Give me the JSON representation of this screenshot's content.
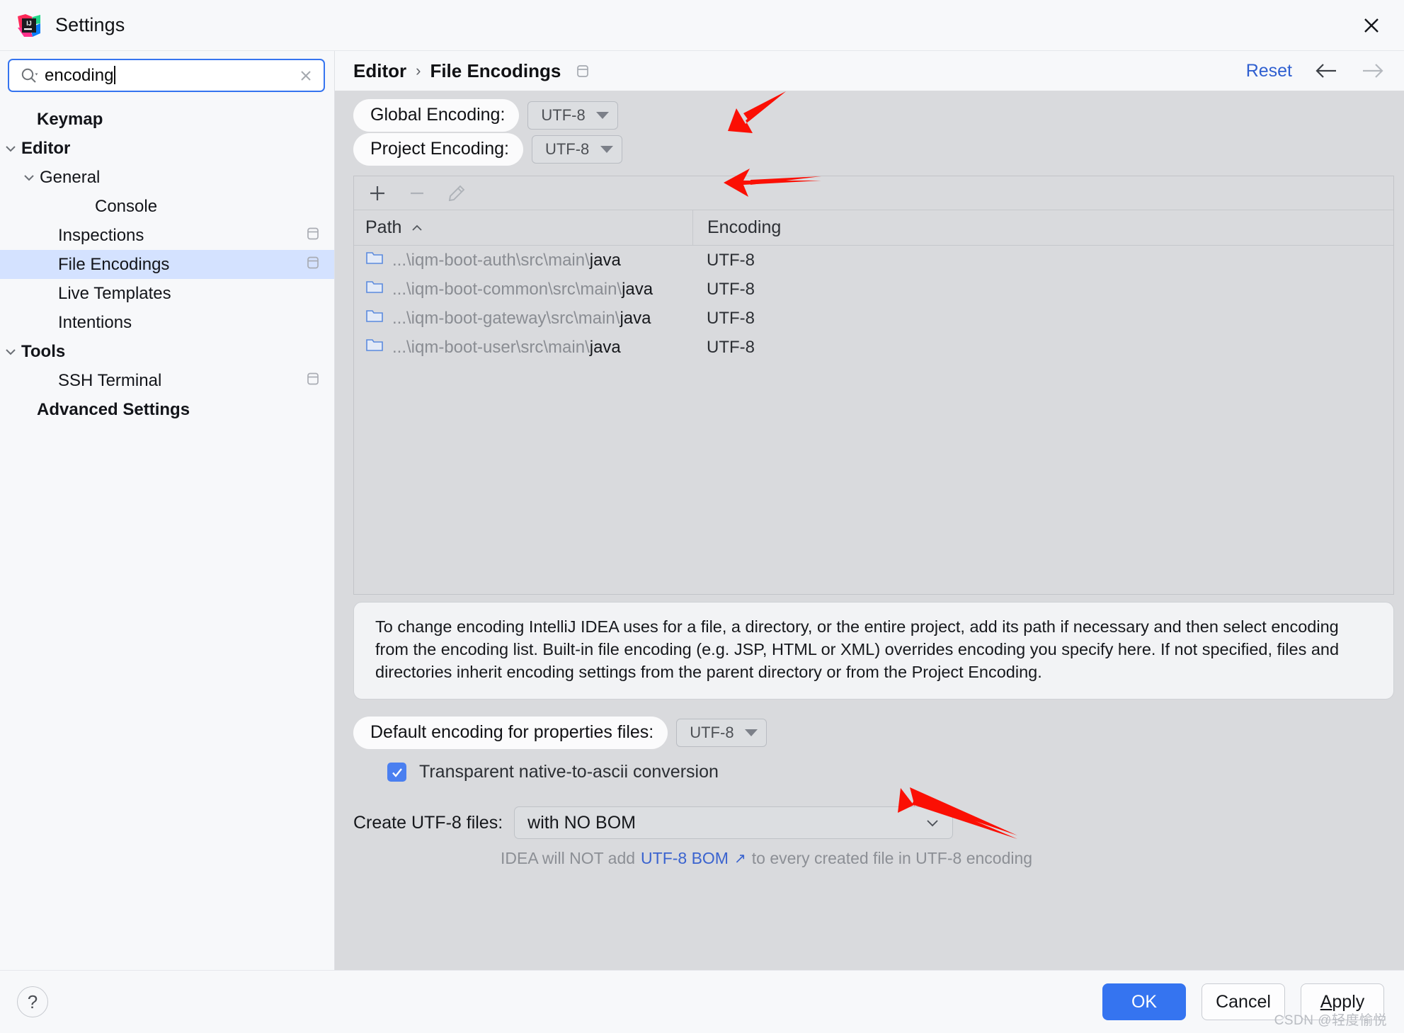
{
  "window": {
    "title": "Settings",
    "logo_icon": "intellij-idea-logo",
    "close_icon": "close-icon"
  },
  "sidebar": {
    "search": {
      "value": "encoding",
      "placeholder": "",
      "search_icon": "search-icon",
      "clear_icon": "clear-icon"
    },
    "items": [
      {
        "label": "Keymap",
        "level": 0,
        "bold": true,
        "arrow": "",
        "selected": false,
        "badge": false
      },
      {
        "label": "Editor",
        "level": 0,
        "bold": true,
        "arrow": "down",
        "selected": false,
        "badge": false
      },
      {
        "label": "General",
        "level": 1,
        "bold": false,
        "arrow": "down",
        "selected": false,
        "badge": false
      },
      {
        "label": "Console",
        "level": 2,
        "bold": false,
        "arrow": "",
        "selected": false,
        "badge": false
      },
      {
        "label": "Inspections",
        "level": 1,
        "bold": false,
        "arrow": "",
        "selected": false,
        "badge": true
      },
      {
        "label": "File Encodings",
        "level": 1,
        "bold": false,
        "arrow": "",
        "selected": true,
        "badge": true
      },
      {
        "label": "Live Templates",
        "level": 1,
        "bold": false,
        "arrow": "",
        "selected": false,
        "badge": false
      },
      {
        "label": "Intentions",
        "level": 1,
        "bold": false,
        "arrow": "",
        "selected": false,
        "badge": false
      },
      {
        "label": "Tools",
        "level": 0,
        "bold": true,
        "arrow": "down",
        "selected": false,
        "badge": false
      },
      {
        "label": "SSH Terminal",
        "level": 1,
        "bold": false,
        "arrow": "",
        "selected": false,
        "badge": true
      },
      {
        "label": "Advanced Settings",
        "level": 0,
        "bold": true,
        "arrow": "",
        "selected": false,
        "badge": false
      }
    ]
  },
  "breadcrumb": {
    "root": "Editor",
    "separator": "›",
    "current": "File Encodings",
    "badge_icon": "project-scope-icon",
    "reset_label": "Reset",
    "back_icon": "arrow-left-icon",
    "forward_icon": "arrow-right-icon"
  },
  "encodings": {
    "global": {
      "label": "Global Encoding:",
      "value": "UTF-8"
    },
    "project": {
      "label": "Project Encoding:",
      "value": "UTF-8"
    }
  },
  "table": {
    "toolbar": {
      "add_icon": "plus-icon",
      "remove_icon": "minus-icon",
      "edit_icon": "pencil-icon"
    },
    "columns": [
      "Path",
      "Encoding"
    ],
    "sort_indicator": "⌃",
    "rows": [
      {
        "folder_icon": "folder-icon",
        "path_dim": "...\\iqm-boot-auth\\src\\main\\",
        "path_strong": "java",
        "encoding": "UTF-8"
      },
      {
        "folder_icon": "folder-icon",
        "path_dim": "...\\iqm-boot-common\\src\\main\\",
        "path_strong": "java",
        "encoding": "UTF-8"
      },
      {
        "folder_icon": "folder-icon",
        "path_dim": "...\\iqm-boot-gateway\\src\\main\\",
        "path_strong": "java",
        "encoding": "UTF-8"
      },
      {
        "folder_icon": "folder-icon",
        "path_dim": "...\\iqm-boot-user\\src\\main\\",
        "path_strong": "java",
        "encoding": "UTF-8"
      }
    ]
  },
  "description": "To change encoding IntelliJ IDEA uses for a file, a directory, or the entire project, add its path if necessary and then select encoding from the encoding list. Built-in file encoding (e.g. JSP, HTML or XML) overrides encoding you specify here. If not specified, files and directories inherit encoding settings from the parent directory or from the Project Encoding.",
  "properties": {
    "label": "Default encoding for properties files:",
    "value": "UTF-8",
    "checkbox": {
      "label": "Transparent native-to-ascii conversion",
      "checked": true
    }
  },
  "create_files": {
    "label": "Create UTF-8 files:",
    "value": "with NO BOM",
    "hint_prefix": "IDEA will NOT add",
    "hint_link": "UTF-8 BOM",
    "hint_external_icon": "↗",
    "hint_suffix": "to every created file in UTF-8 encoding"
  },
  "footer": {
    "help_label": "?",
    "ok_label": "OK",
    "cancel_label": "Cancel",
    "apply_mnemonic": "A",
    "apply_rest": "pply"
  },
  "watermark": "CSDN @轻度愉悦",
  "colors": {
    "accent": "#3574f0",
    "selection": "#d4e2ff",
    "link": "#2f5fd0",
    "annotation_arrow": "#fb0f04",
    "panel_bg": "#d9dadd",
    "chrome_bg": "#f7f8fa"
  }
}
